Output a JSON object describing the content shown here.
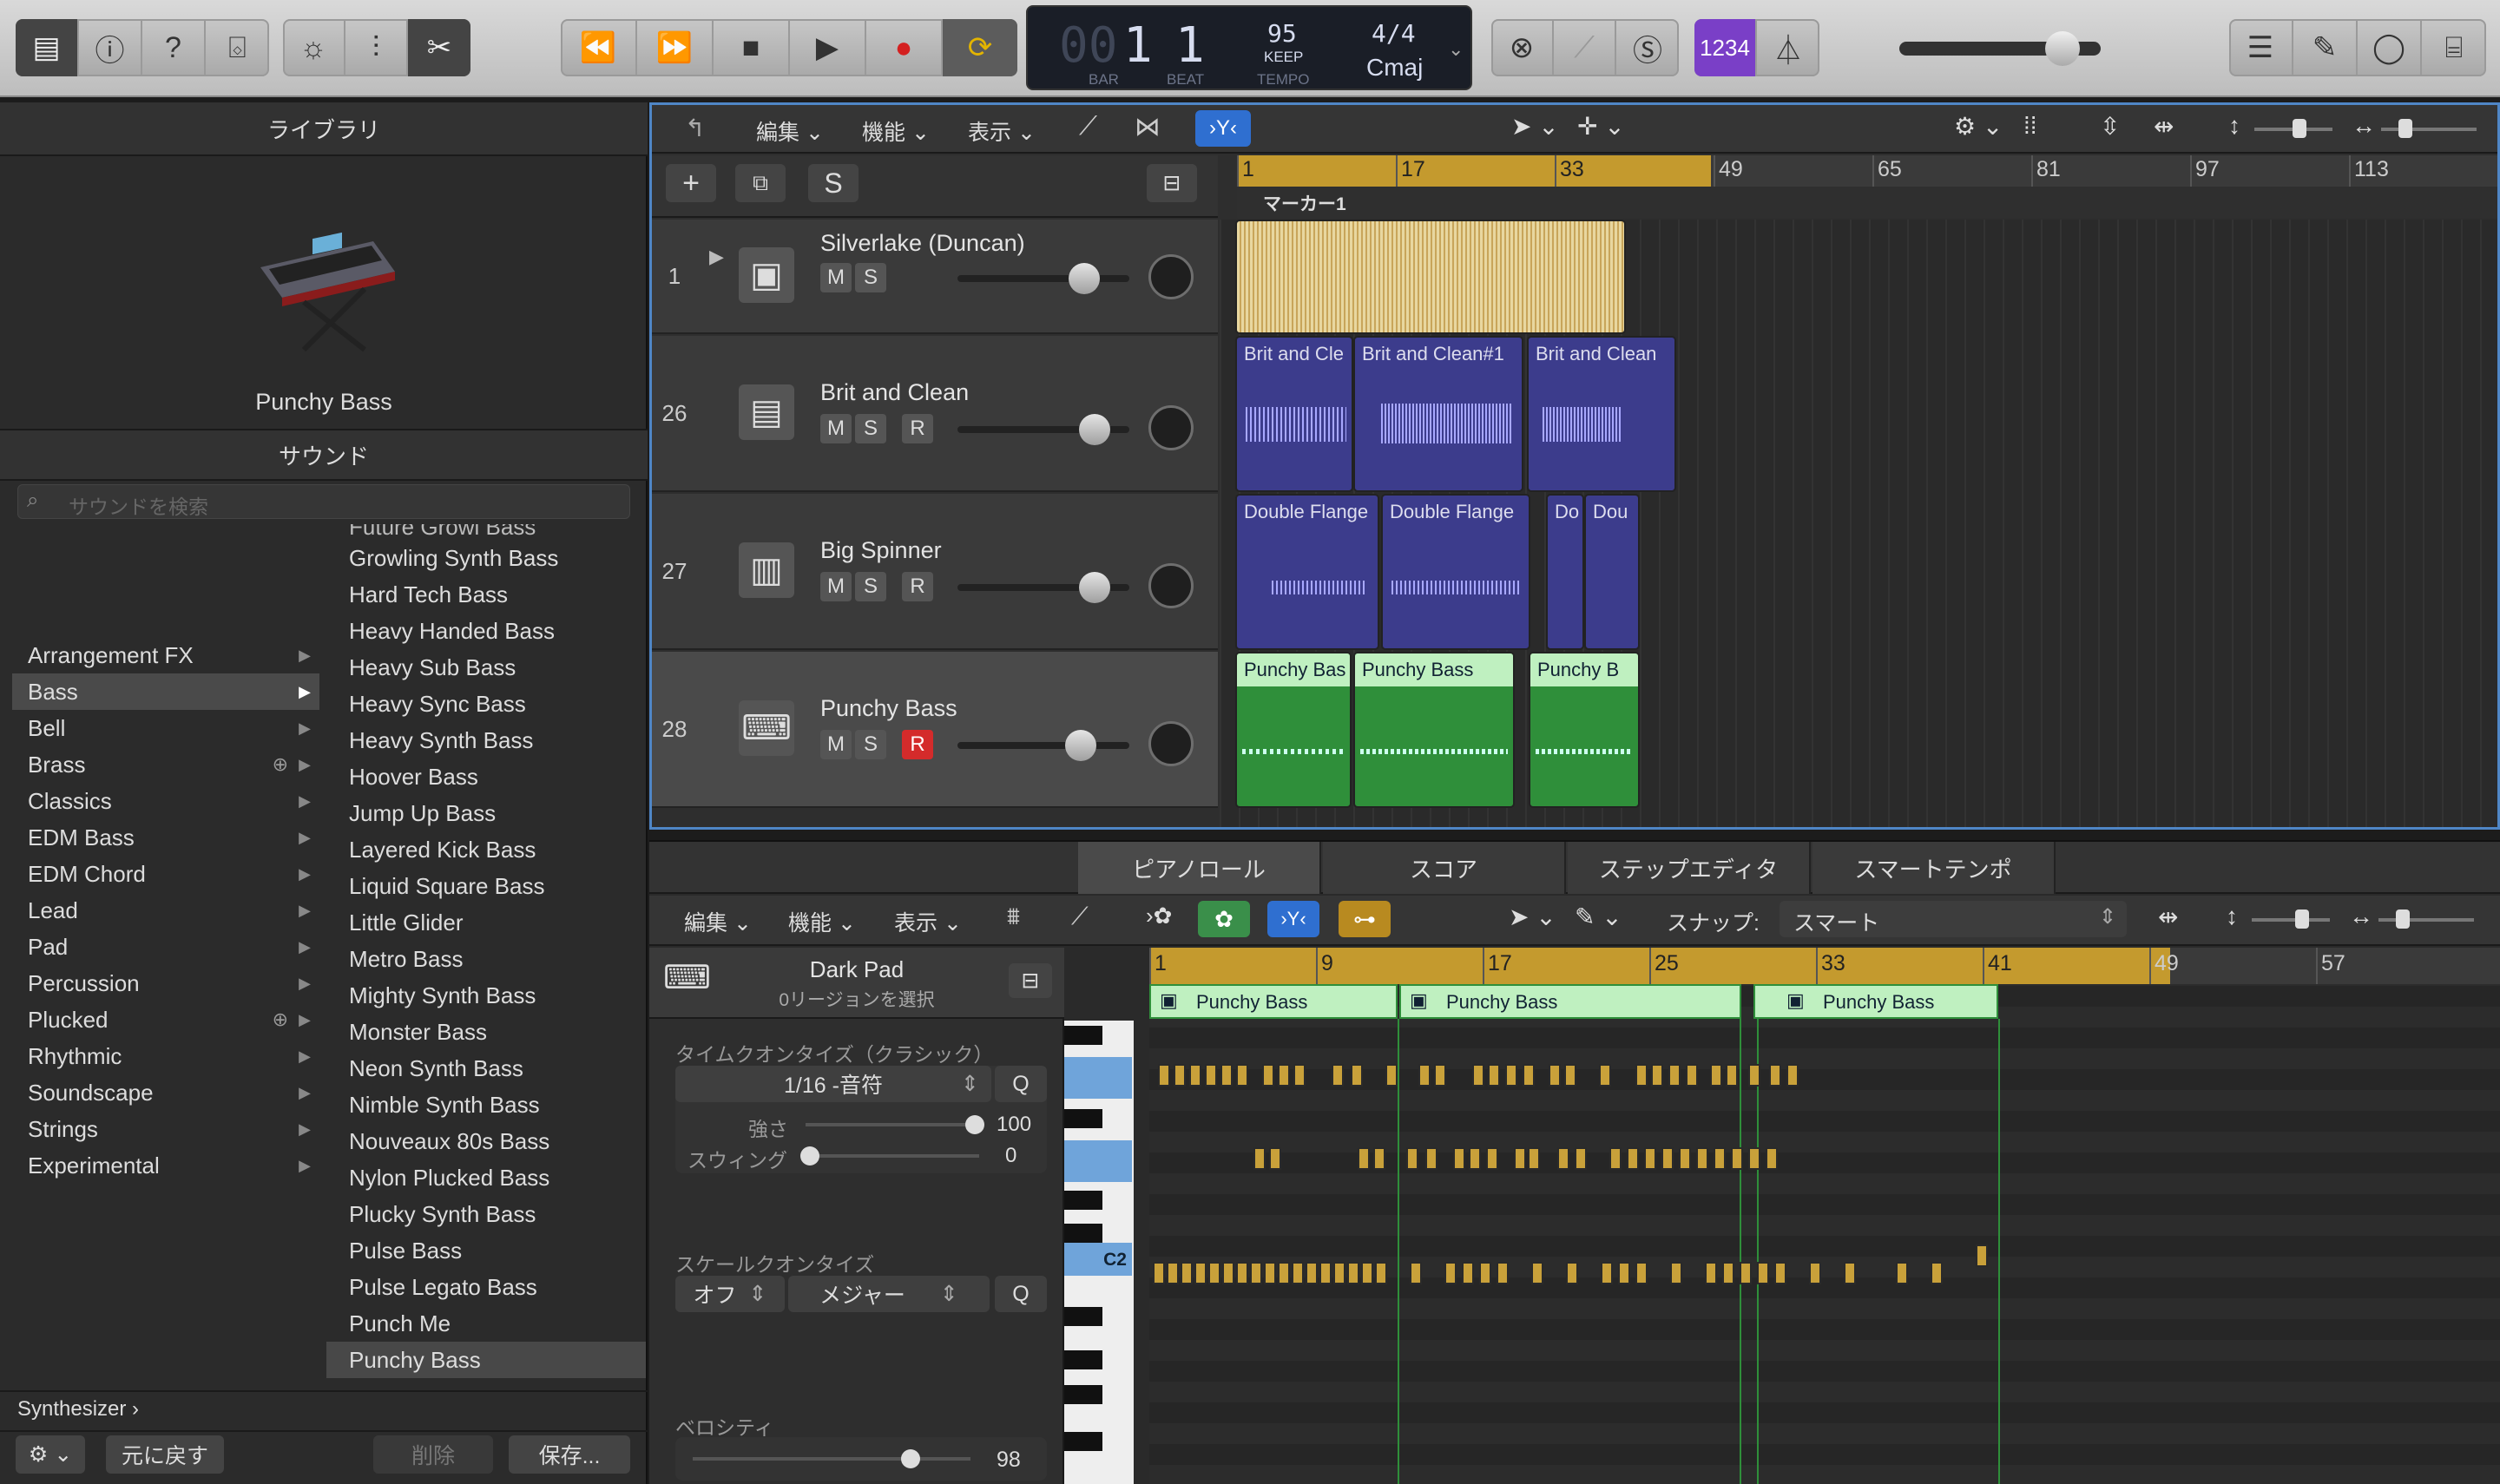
{
  "transport": {
    "bar": "1",
    "beat": "1",
    "bar_label": "BAR",
    "beat_label": "BEAT",
    "tempo": "95",
    "tempo_mode": "KEEP",
    "tempo_label": "TEMPO",
    "signature": "4/4",
    "key": "Cmaj",
    "lcd_prefix": "00",
    "count_in": "1234"
  },
  "library": {
    "title": "ライブラリ",
    "patch_name": "Punchy Bass",
    "sound_header": "サウンド",
    "search_placeholder": "サウンドを検索",
    "categories": [
      "Arrangement FX",
      "Bass",
      "Bell",
      "Brass",
      "Classics",
      "EDM Bass",
      "EDM Chord",
      "Lead",
      "Pad",
      "Percussion",
      "Plucked",
      "Rhythmic",
      "Soundscape",
      "Strings",
      "Experimental"
    ],
    "sounds": [
      "Growling Synth Bass",
      "Hard Tech Bass",
      "Heavy Handed Bass",
      "Heavy Sub Bass",
      "Heavy Sync Bass",
      "Heavy Synth Bass",
      "Hoover Bass",
      "Jump Up Bass",
      "Layered Kick Bass",
      "Liquid Square Bass",
      "Little Glider",
      "Metro Bass",
      "Mighty Synth Bass",
      "Monster Bass",
      "Neon Synth Bass",
      "Nimble Synth Bass",
      "Nouveaux 80s Bass",
      "Nylon Plucked Bass",
      "Plucky Synth Bass",
      "Pulse Bass",
      "Pulse Legato Bass",
      "Punch Me",
      "Punchy Bass"
    ],
    "footer_path": "Synthesizer",
    "revert": "元に戻す",
    "delete": "削除",
    "save": "保存..."
  },
  "tracks_menu": {
    "edit": "編集",
    "function": "機能",
    "view": "表示",
    "s_button": "S"
  },
  "ruler": {
    "marks": [
      "1",
      "17",
      "33",
      "49",
      "65",
      "81",
      "97",
      "113"
    ],
    "marker": "マーカー1"
  },
  "tracks": [
    {
      "num": "1",
      "name": "Silverlake (Duncan)",
      "m": "M",
      "s": "S"
    },
    {
      "num": "26",
      "name": "Brit and Clean",
      "m": "M",
      "s": "S",
      "r": "R",
      "regions": [
        "Brit and Cle",
        "Brit and Clean#1",
        "Brit and Clean"
      ]
    },
    {
      "num": "27",
      "name": "Big Spinner",
      "m": "M",
      "s": "S",
      "r": "R",
      "regions": [
        "Double Flange",
        "Double Flange",
        "Do",
        "Dou"
      ]
    },
    {
      "num": "28",
      "name": "Punchy Bass",
      "m": "M",
      "s": "S",
      "r": "R",
      "regions": [
        "Punchy Bas",
        "Punchy Bass",
        "Punchy B"
      ]
    }
  ],
  "editor": {
    "tabs": [
      "ピアノロール",
      "スコア",
      "ステップエディタ",
      "スマートテンポ"
    ],
    "edit": "編集",
    "function": "機能",
    "view": "表示",
    "snap_label": "スナップ:",
    "snap_value": "スマート",
    "region_name": "Dark Pad",
    "region_sub": "0リージョンを選択",
    "time_quantize": "タイムクオンタイズ（クラシック）",
    "quant_value": "1/16 -音符",
    "q": "Q",
    "strength_label": "強さ",
    "strength": "100",
    "swing_label": "スウィング",
    "swing": "0",
    "scale_quantize": "スケールクオンタイズ",
    "scale_off": "オフ",
    "scale_type": "メジャー",
    "velocity_label": "ベロシティ",
    "velocity": "98",
    "c2": "C2",
    "ruler": [
      "1",
      "9",
      "17",
      "25",
      "33",
      "41",
      "49",
      "57"
    ],
    "regions": [
      "Punchy Bass",
      "Punchy Bass",
      "Punchy Bass"
    ]
  },
  "colors": {
    "accent": "#4f86c6",
    "audio_region": "#e8d7a0",
    "blue_region": "#3c3c8c",
    "green_region": "#2f8f3a",
    "lcd": "#1a1e27"
  }
}
